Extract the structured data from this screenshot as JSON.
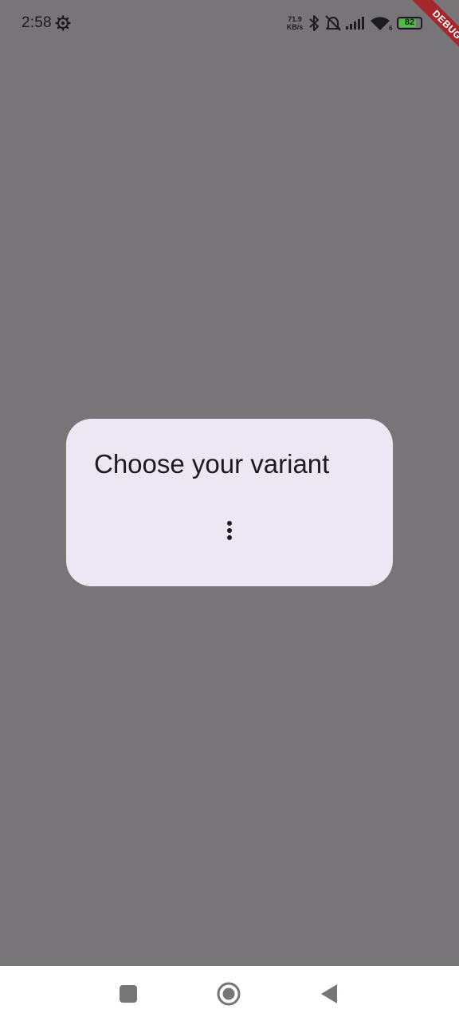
{
  "status_bar": {
    "time": "2:58",
    "net_speed_value": "71.9",
    "net_speed_unit": "KB/s",
    "battery_level": "82",
    "battery_fraction": 0.82,
    "icons": [
      "settings-gear-icon",
      "bluetooth-icon",
      "bell-off-icon",
      "signal-icon",
      "wifi-icon",
      "battery-icon"
    ]
  },
  "debug_banner": {
    "label": "DEBUG",
    "color": "#a5272b"
  },
  "dialog": {
    "title": "Choose your variant",
    "menu_icon": "more-vert-icon",
    "background": "#ede6f3"
  },
  "nav_bar": {
    "buttons": [
      "recent-apps-icon",
      "home-icon",
      "back-icon"
    ]
  },
  "colors": {
    "scrim": "#777578",
    "text": "#1c1b1f",
    "battery_fill": "#46c33a"
  }
}
